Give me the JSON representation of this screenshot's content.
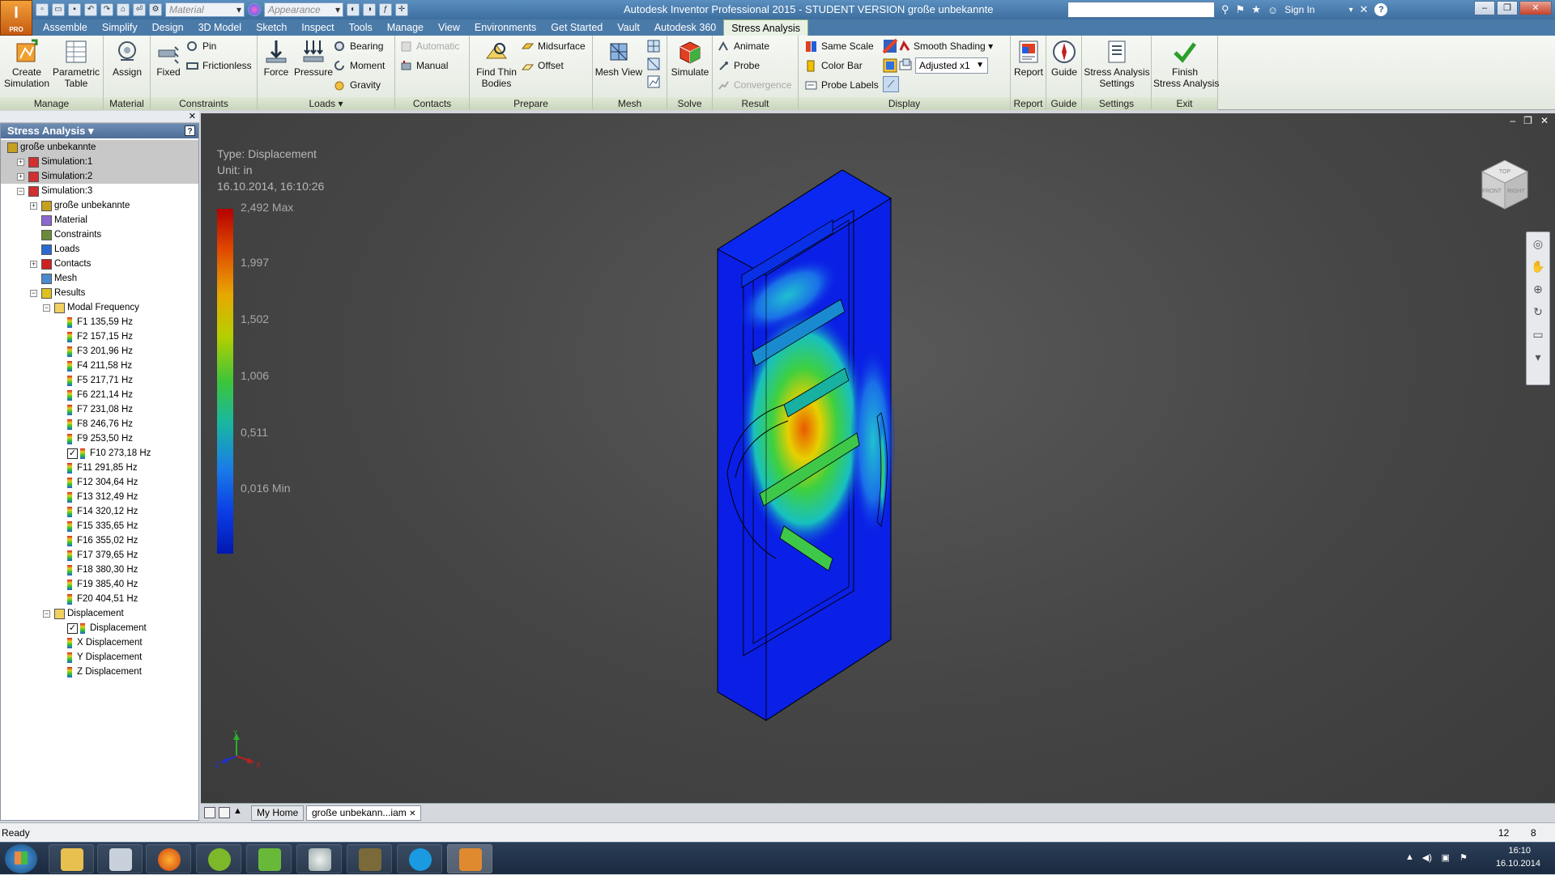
{
  "app": {
    "icon_letter": "I",
    "icon_sub": "PRO",
    "title": "Autodesk Inventor Professional 2015 - STUDENT VERSION   große unbekannte",
    "material_placeholder": "Material",
    "appearance_placeholder": "Appearance",
    "sign_in": "Sign In",
    "search_value": ""
  },
  "menu_tabs": [
    "Assemble",
    "Simplify",
    "Design",
    "3D Model",
    "Sketch",
    "Inspect",
    "Tools",
    "Manage",
    "View",
    "Environments",
    "Get Started",
    "Vault",
    "Autodesk 360",
    "Stress Analysis"
  ],
  "active_tab": "Stress Analysis",
  "ribbon": {
    "manage": {
      "label": "Manage",
      "create_simulation": "Create\nSimulation",
      "parametric_table": "Parametric\nTable"
    },
    "material": {
      "label": "Material",
      "assign": "Assign"
    },
    "constraints": {
      "label": "Constraints",
      "fixed": "Fixed",
      "pin": "Pin",
      "frictionless": "Frictionless"
    },
    "loads": {
      "label": "Loads ▾",
      "force": "Force",
      "pressure": "Pressure",
      "bearing": "Bearing",
      "moment": "Moment",
      "gravity": "Gravity"
    },
    "contacts": {
      "label": "Contacts",
      "automatic": "Automatic",
      "manual": "Manual"
    },
    "prepare": {
      "label": "Prepare",
      "find_thin_bodies": "Find Thin\nBodies",
      "midsurface": "Midsurface",
      "offset": "Offset"
    },
    "mesh": {
      "label": "Mesh",
      "mesh_view": "Mesh View"
    },
    "solve": {
      "label": "Solve",
      "simulate": "Simulate"
    },
    "result": {
      "label": "Result",
      "animate": "Animate",
      "probe": "Probe",
      "convergence": "Convergence"
    },
    "display": {
      "label": "Display",
      "same_scale": "Same Scale",
      "color_bar": "Color Bar",
      "probe_labels": "Probe Labels",
      "smooth_shading": "Smooth Shading",
      "adjusted": "Adjusted x1"
    },
    "report": {
      "label": "Report",
      "report": "Report"
    },
    "guide": {
      "label": "Guide",
      "guide": "Guide"
    },
    "settings": {
      "label": "Settings",
      "stress_analysis_settings": "Stress Analysis\nSettings"
    },
    "exit": {
      "label": "Exit",
      "finish": "Finish\nStress Analysis"
    }
  },
  "browser": {
    "title": "Stress Analysis ▾",
    "root": "große unbekannte",
    "sim1": "Simulation:1",
    "sim2": "Simulation:2",
    "sim3": "Simulation:3",
    "assembly": "große unbekannte",
    "material": "Material",
    "constraints": "Constraints",
    "loads": "Loads",
    "contacts": "Contacts",
    "mesh": "Mesh",
    "results": "Results",
    "modal_frequency": "Modal Frequency",
    "frequencies": [
      "F1  135,59 Hz",
      "F2  157,15 Hz",
      "F3  201,96 Hz",
      "F4  211,58 Hz",
      "F5  217,71 Hz",
      "F6  221,14 Hz",
      "F7  231,08 Hz",
      "F8  246,76 Hz",
      "F9  253,50 Hz",
      "F10  273,18 Hz",
      "F11  291,85 Hz",
      "F12  304,64 Hz",
      "F13  312,49 Hz",
      "F14  320,12 Hz",
      "F15  335,65 Hz",
      "F16  355,02 Hz",
      "F17  379,65 Hz",
      "F18  380,30 Hz",
      "F19  385,40 Hz",
      "F20  404,51 Hz"
    ],
    "checked_frequency": "F10  273,18 Hz",
    "displacement_folder": "Displacement",
    "displacement_items": [
      "Displacement",
      "X Displacement",
      "Y Displacement",
      "Z Displacement"
    ],
    "checked_displacement": "Displacement"
  },
  "viewport": {
    "type_line": "Type: Displacement",
    "unit_line": "Unit: in",
    "date_line": "16.10.2014, 16:10:26",
    "colorbar_labels": [
      "2,492 Max",
      "1,997",
      "1,502",
      "1,006",
      "0,511",
      "0,016 Min"
    ],
    "viewcube_labels": [
      "TOP",
      "FRONT",
      "RIGHT"
    ],
    "triad": {
      "x": "X",
      "y": "Y",
      "z": "Z"
    }
  },
  "doc_tabs": [
    "My Home",
    "große unbekann...iam"
  ],
  "status": {
    "text": "Ready",
    "count_a": "12",
    "count_b": "8"
  },
  "taskbar": {
    "time": "16:10",
    "date": "16.10.2014"
  }
}
